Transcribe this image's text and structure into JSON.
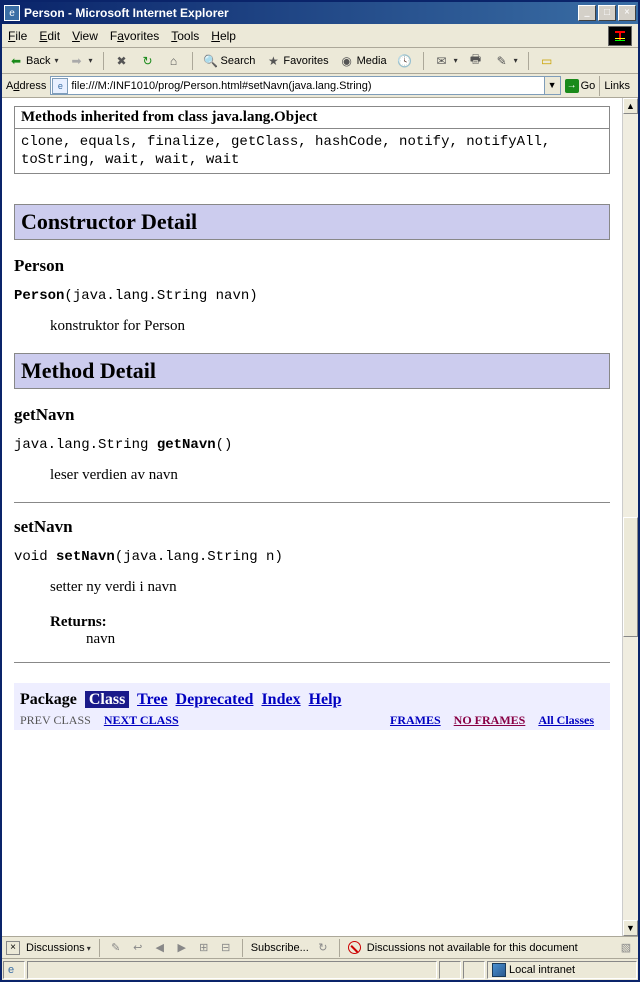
{
  "window": {
    "title": "Person - Microsoft Internet Explorer"
  },
  "menu": {
    "file": "File",
    "edit": "Edit",
    "view": "View",
    "favorites": "Favorites",
    "tools": "Tools",
    "help": "Help"
  },
  "toolbar": {
    "back": "Back",
    "search": "Search",
    "favorites": "Favorites",
    "media": "Media"
  },
  "address": {
    "label": "Address",
    "value": "file:///M:/INF1010/prog/Person.html#setNavn(java.lang.String)",
    "go": "Go",
    "links": "Links"
  },
  "page": {
    "inheritHeader": "Methods inherited from class java.lang.Object",
    "inheritBody": "clone, equals, finalize, getClass, hashCode, notify, notifyAll, toString, wait, wait, wait",
    "constructorDetail": "Constructor Detail",
    "person": {
      "name": "Person",
      "sigPrefix": "Person",
      "sigArgs": "(java.lang.String navn)",
      "desc": "konstruktor for Person"
    },
    "methodDetail": "Method Detail",
    "getNavn": {
      "name": "getNavn",
      "sigPre": "java.lang.String ",
      "sigName": "getNavn",
      "sigArgs": "()",
      "desc": "leser verdien av navn"
    },
    "setNavn": {
      "name": "setNavn",
      "sigPre": "void ",
      "sigName": "setNavn",
      "sigArgs": "(java.lang.String n)",
      "desc": "setter ny verdi i navn",
      "returnsLabel": "Returns:",
      "returnsVal": "navn"
    },
    "nav": {
      "package": "Package",
      "class": "Class",
      "tree": "Tree",
      "deprecated": "Deprecated",
      "index": "Index",
      "help": "Help",
      "prev": "PREV CLASS",
      "next": "NEXT CLASS",
      "frames": "FRAMES",
      "noframes": "NO FRAMES",
      "all": "All Classes"
    }
  },
  "disc": {
    "label": "Discussions",
    "subscribe": "Subscribe...",
    "msg": "Discussions not available for this document"
  },
  "status": {
    "zone": "Local intranet"
  }
}
